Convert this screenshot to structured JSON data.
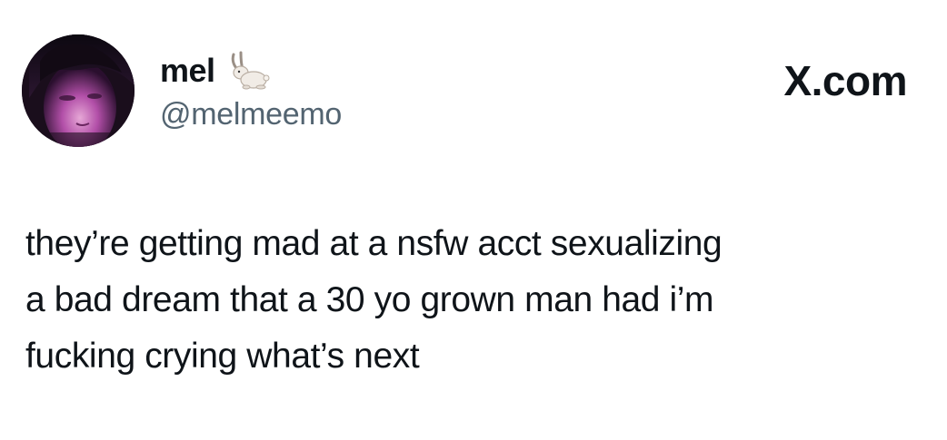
{
  "author": {
    "display_name": "mel",
    "handle": "@melmeemo",
    "name_emoji": "rabbit-icon"
  },
  "brand": {
    "label": "X.com"
  },
  "tweet": {
    "lines": [
      "they’re getting mad at a nsfw acct sexualizing",
      "a bad dream that a 30 yo grown man had i’m",
      "fucking crying what’s next"
    ]
  },
  "colors": {
    "text_primary": "#0f1419",
    "text_secondary": "#536471",
    "background": "#ffffff"
  }
}
